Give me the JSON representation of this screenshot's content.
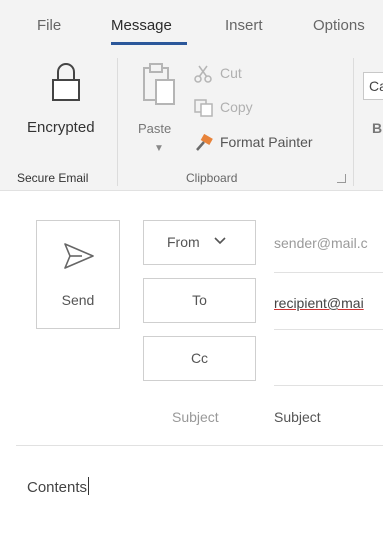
{
  "menu": {
    "tabs": [
      {
        "label": "File"
      },
      {
        "label": "Message",
        "active": true
      },
      {
        "label": "Insert"
      },
      {
        "label": "Options"
      }
    ]
  },
  "ribbon": {
    "secure_email": {
      "group_label": "Secure Email",
      "encrypted_label": "Encrypted",
      "icon": "lock-icon"
    },
    "clipboard": {
      "group_label": "Clipboard",
      "paste_label": "Paste",
      "cut_label": "Cut",
      "copy_label": "Copy",
      "format_painter_label": "Format Painter",
      "icons": [
        "paste-icon",
        "scissors-icon",
        "copy-icon",
        "format-painter-icon",
        "dialog-launcher-icon"
      ]
    },
    "font": {
      "font_name_partial": "Ca",
      "bold_partial": "B"
    }
  },
  "compose": {
    "send_label": "Send",
    "send_icon": "send-icon",
    "from_label": "From",
    "from_value": "sender@mail.c",
    "to_label": "To",
    "to_value": "recipient@mai",
    "cc_label": "Cc",
    "cc_value": "",
    "subject_label": "Subject",
    "subject_placeholder": "Subject",
    "body_text": "Contents"
  },
  "colors": {
    "accent": "#2b579a",
    "ribbon_background": "#f3f3f3",
    "format_painter_brush": "#e8833a"
  }
}
